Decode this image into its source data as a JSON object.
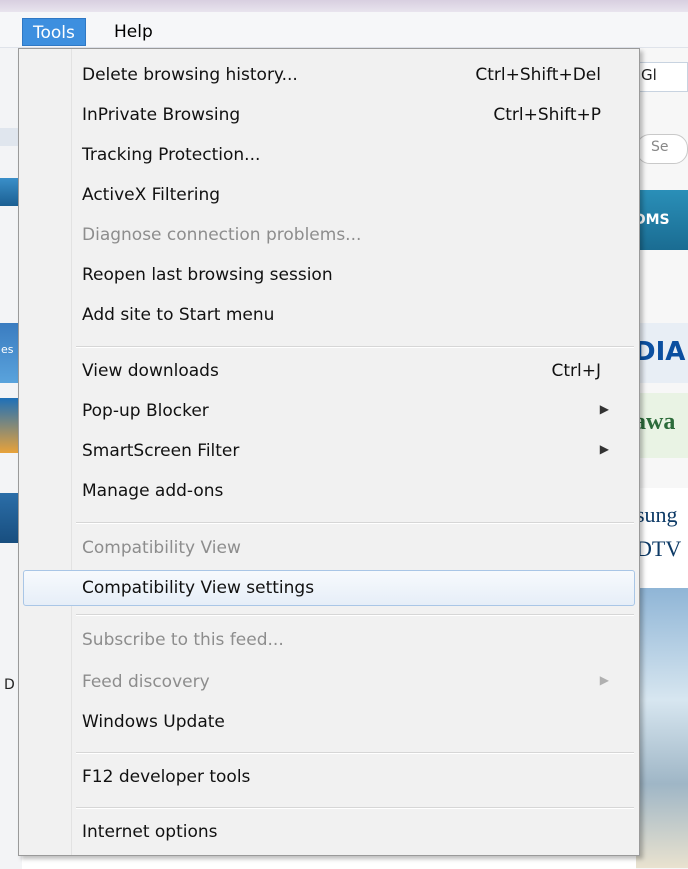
{
  "menubar": {
    "tools_label": "Tools",
    "help_label": "Help"
  },
  "background": {
    "right_text_1": "Gl",
    "right_text_2": "Se",
    "right_text_3": "DMS",
    "right_text_4": "DIA",
    "right_text_5": "awa",
    "right_text_6": "sung",
    "right_text_7": "DTV",
    "left_text_1": "es",
    "left_text_2": "D"
  },
  "menu": {
    "items": [
      {
        "label": "Delete browsing history...",
        "shortcut": "Ctrl+Shift+Del"
      },
      {
        "label": "InPrivate Browsing",
        "shortcut": "Ctrl+Shift+P"
      },
      {
        "label": "Tracking Protection..."
      },
      {
        "label": "ActiveX Filtering"
      },
      {
        "label": "Diagnose connection problems..."
      },
      {
        "label": "Reopen last browsing session"
      },
      {
        "label": "Add site to Start menu"
      },
      {
        "label": "View downloads",
        "shortcut": "Ctrl+J"
      },
      {
        "label": "Pop-up Blocker"
      },
      {
        "label": "SmartScreen Filter"
      },
      {
        "label": "Manage add-ons"
      },
      {
        "label": "Compatibility View"
      },
      {
        "label": "Compatibility View settings"
      },
      {
        "label": "Subscribe to this feed..."
      },
      {
        "label": "Feed discovery"
      },
      {
        "label": "Windows Update"
      },
      {
        "label": "F12 developer tools"
      },
      {
        "label": "Internet options"
      }
    ]
  },
  "colors": {
    "menu_highlight": "#3d8fdf",
    "disabled_text": "#8d8d8d"
  }
}
